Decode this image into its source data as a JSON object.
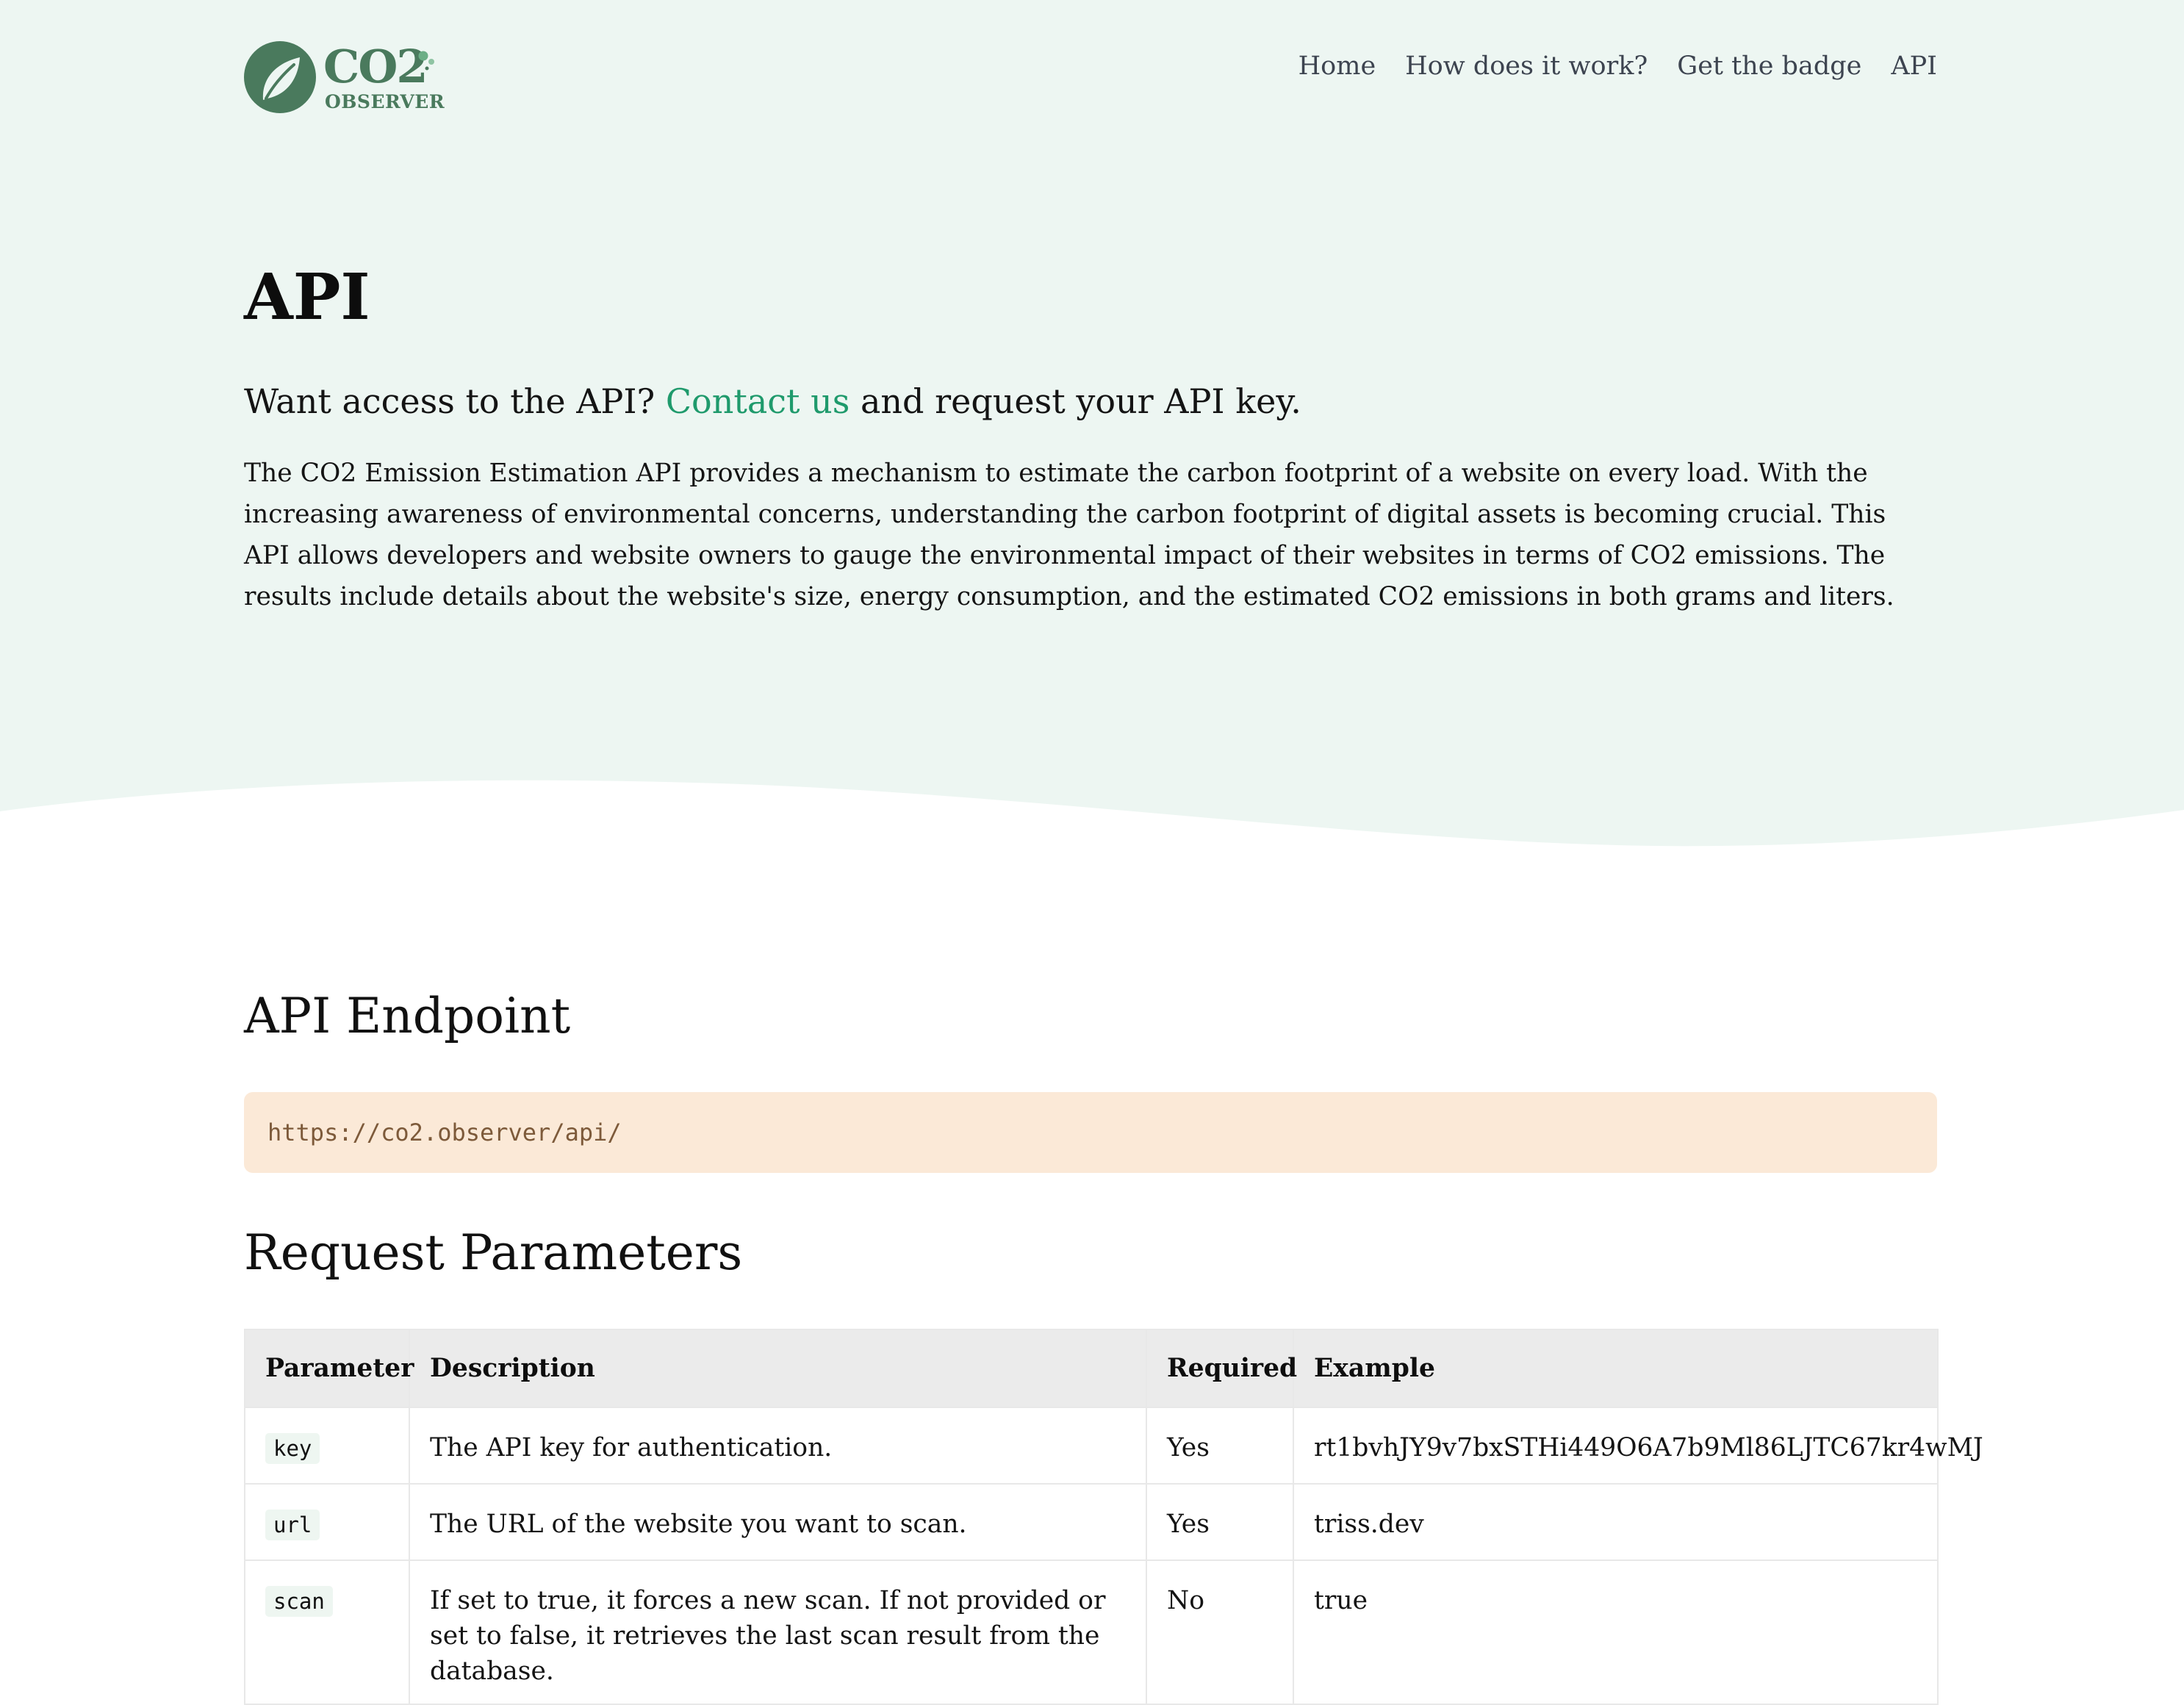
{
  "brand": {
    "logo_main": "CO2",
    "logo_sub": "OBSERVER"
  },
  "nav": {
    "items": [
      {
        "label": "Home"
      },
      {
        "label": "How does it work?"
      },
      {
        "label": "Get the badge"
      },
      {
        "label": "API"
      }
    ]
  },
  "hero": {
    "title": "API",
    "lead_before": "Want access to the API?",
    "lead_link": "Contact us",
    "lead_after": "and request your API key.",
    "intro": "The CO2 Emission Estimation API provides a mechanism to estimate the carbon footprint of a website on every load. With the increasing awareness of environmental concerns, understanding the carbon footprint of digital assets is becoming crucial. This API allows developers and website owners to gauge the environmental impact of their websites in terms of CO2 emissions. The results include details about the website's size, energy consumption, and the estimated CO2 emissions in both grams and liters."
  },
  "endpoint": {
    "heading": "API Endpoint",
    "url": "https://co2.observer/api/"
  },
  "params": {
    "heading": "Request Parameters",
    "columns": [
      "Parameter",
      "Description",
      "Required",
      "Example"
    ],
    "rows": [
      {
        "parameter": "key",
        "description": "The API key for authentication.",
        "required": "Yes",
        "example": "rt1bvhJY9v7bxSTHi449O6A7b9Ml86LJTC67kr4wMJ"
      },
      {
        "parameter": "url",
        "description": "The URL of the website you want to scan.",
        "required": "Yes",
        "example": "triss.dev"
      },
      {
        "parameter": "scan",
        "description": "If set to true, it forces a new scan. If not provided or set to false, it retrieves the last scan result from the database.",
        "required": "No",
        "example": "true"
      }
    ]
  },
  "colors": {
    "hero_background": "#edf6f2",
    "brand_green": "#4a7a5d",
    "link_green": "#1f9a6c",
    "endpoint_background": "#fbe9d7",
    "endpoint_text": "#7d5a3a",
    "table_header_background": "#ebebeb",
    "code_background": "#eef6f1"
  },
  "icons": {
    "logo": "leaf-icon"
  }
}
